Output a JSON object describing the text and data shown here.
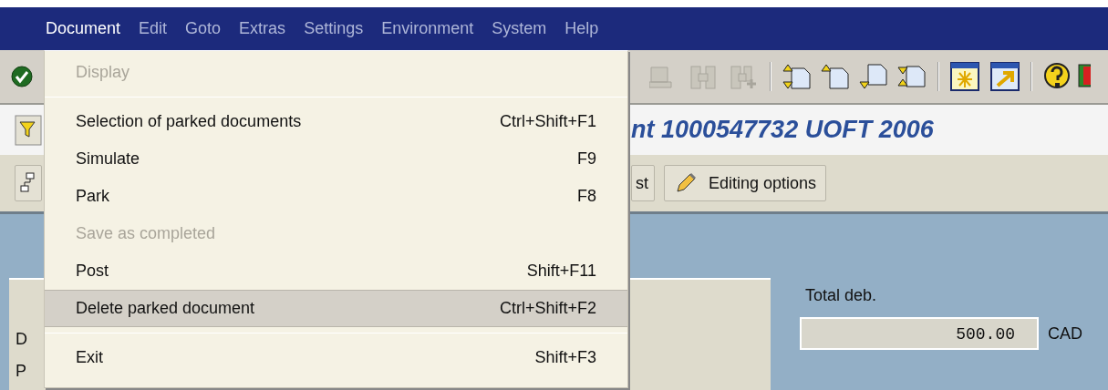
{
  "menu_bar": [
    {
      "label": "Document",
      "selected": true
    },
    {
      "label": "Edit",
      "selected": false
    },
    {
      "label": "Goto",
      "selected": false
    },
    {
      "label": "Extras",
      "selected": false
    },
    {
      "label": "Settings",
      "selected": false
    },
    {
      "label": "Environment",
      "selected": false
    },
    {
      "label": "System",
      "selected": false
    },
    {
      "label": "Help",
      "selected": false
    }
  ],
  "title": "nt 1000547732 UOFT 2006",
  "app_toolbar": {
    "buttons": [
      {
        "label": "st",
        "kind": "text"
      },
      {
        "label": "Editing options",
        "kind": "pencil"
      }
    ]
  },
  "dropdown": [
    {
      "kind": "item",
      "label": "Display",
      "disabled": true,
      "selected": false
    },
    {
      "kind": "separator"
    },
    {
      "kind": "item",
      "label": "Selection of parked documents",
      "shortcut": "Ctrl+Shift+F1",
      "disabled": false,
      "selected": false
    },
    {
      "kind": "item",
      "label": "Simulate",
      "shortcut": "F9",
      "disabled": false,
      "selected": false
    },
    {
      "kind": "item",
      "label": "Park",
      "shortcut": "F8",
      "disabled": false,
      "selected": false
    },
    {
      "kind": "item",
      "label": "Save as completed",
      "disabled": true,
      "selected": false
    },
    {
      "kind": "item",
      "label": "Post",
      "shortcut": "Shift+F11",
      "disabled": false,
      "selected": false
    },
    {
      "kind": "item",
      "label": "Delete parked document",
      "shortcut": "Ctrl+Shift+F2",
      "disabled": false,
      "selected": true
    },
    {
      "kind": "separator"
    },
    {
      "kind": "item",
      "label": "Exit",
      "shortcut": "Shift+F3",
      "disabled": false,
      "selected": false
    }
  ],
  "form": {
    "row_labels": [
      "D",
      "P"
    ],
    "total_debit": {
      "label": "Total deb.",
      "value": "500.00",
      "currency": "CAD"
    }
  }
}
